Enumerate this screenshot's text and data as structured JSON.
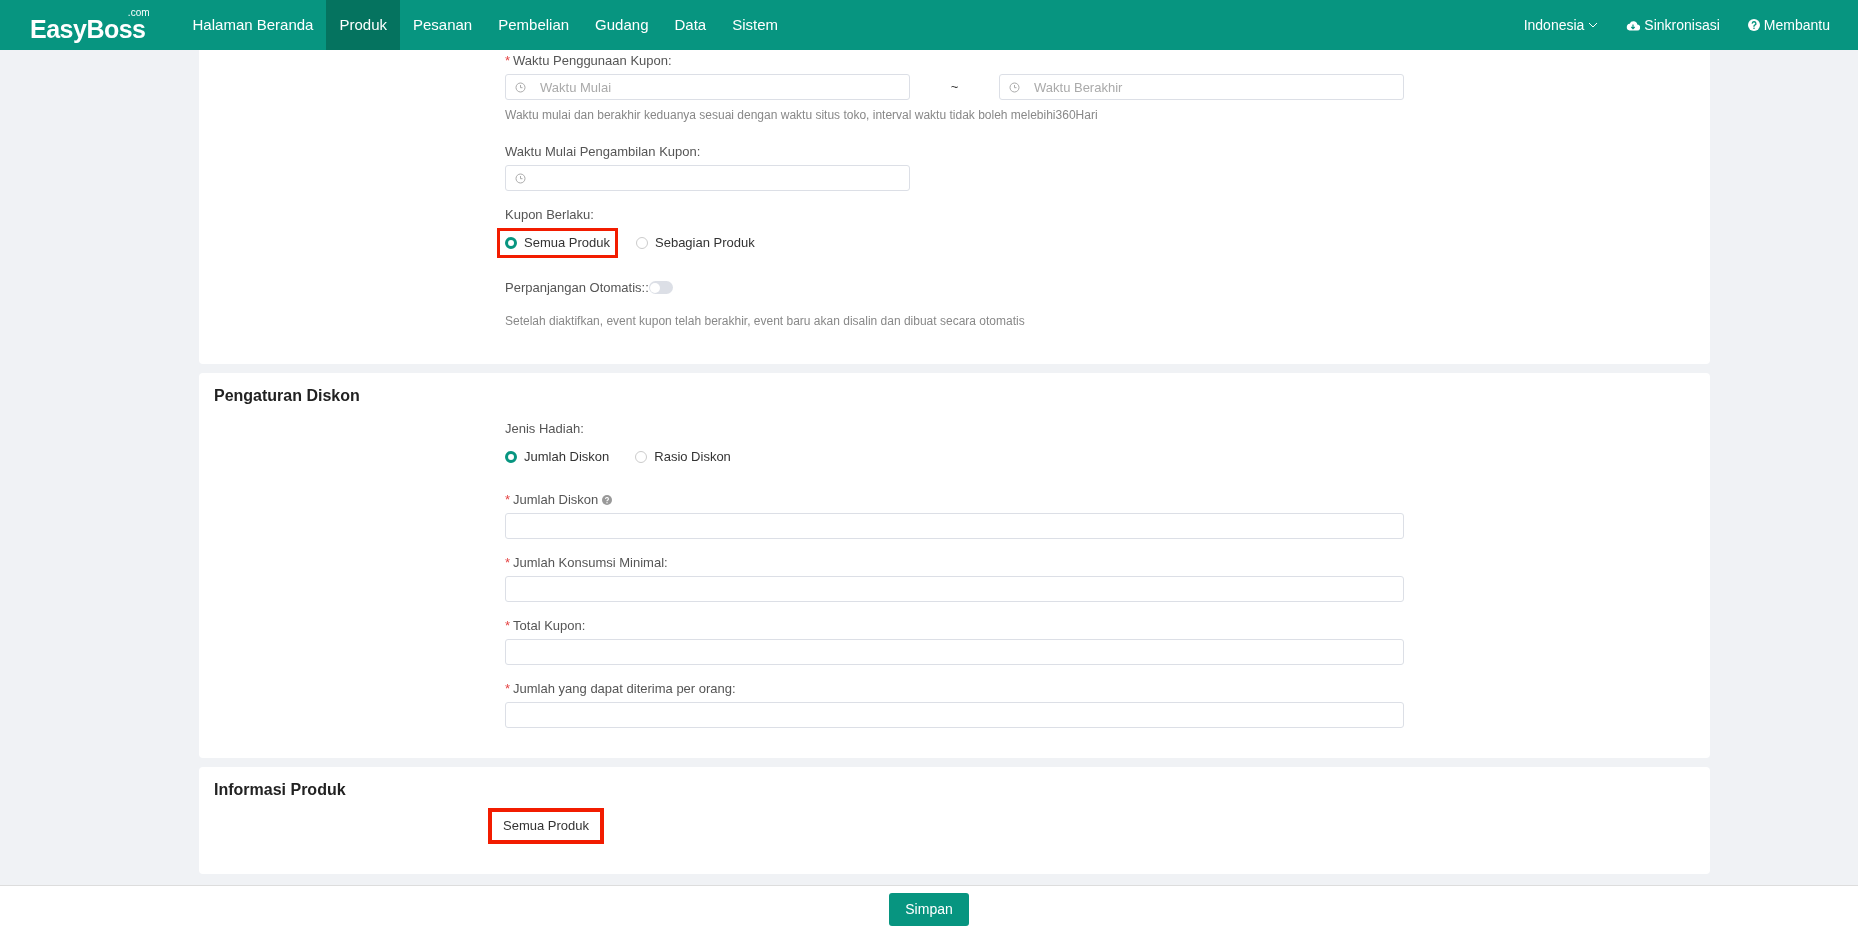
{
  "navbar": {
    "logo": "EasyBoss",
    "logo_suffix": ".com",
    "menu": [
      {
        "label": "Halaman Beranda",
        "selected": false
      },
      {
        "label": "Produk",
        "selected": true
      },
      {
        "label": "Pesanan",
        "selected": false
      },
      {
        "label": "Pembelian",
        "selected": false
      },
      {
        "label": "Gudang",
        "selected": false
      },
      {
        "label": "Data",
        "selected": false
      },
      {
        "label": "Sistem",
        "selected": false
      }
    ],
    "right": [
      {
        "kind": "dropdown",
        "label": "Indonesia"
      },
      {
        "kind": "sync",
        "label": "Sinkronisasi"
      },
      {
        "kind": "help",
        "label": "Membantu"
      }
    ]
  },
  "sections": [
    {
      "fields": [
        {
          "kind": "daterange",
          "mark": "*",
          "label": "Waktu Penggunaan Kupon:",
          "start_placeholder": "Waktu Mulai",
          "separator": "~",
          "end_placeholder": "Waktu Berakhir",
          "hint": "Waktu mulai dan berakhir keduanya sesuai dengan waktu situs toko, interval waktu tidak boleh melebihi360Hari"
        },
        {
          "kind": "datetime",
          "label": "Waktu Mulai Pengambilan Kupon:"
        },
        {
          "kind": "radio",
          "label": "Kupon Berlaku:",
          "options": [
            {
              "label": "Semua Produk",
              "selected": true,
              "highlighted": true
            },
            {
              "label": "Sebagian Produk",
              "selected": false,
              "highlighted": false
            }
          ]
        },
        {
          "kind": "toggle",
          "label": "Perpanjangan Otomatis::",
          "on": false,
          "hint": "Setelah diaktifkan, event kupon telah berakhir, event baru akan disalin dan dibuat secara otomatis"
        }
      ]
    },
    {
      "title": "Pengaturan Diskon",
      "fields": [
        {
          "kind": "radio",
          "label": "Jenis Hadiah:",
          "options": [
            {
              "label": "Jumlah Diskon",
              "selected": true,
              "highlighted": false
            },
            {
              "label": "Rasio Diskon",
              "selected": false,
              "highlighted": false
            }
          ]
        },
        {
          "kind": "input",
          "mark": "*",
          "label": "Jumlah Diskon",
          "help": true
        },
        {
          "kind": "input",
          "mark": "*",
          "label": "Jumlah Konsumsi Minimal:"
        },
        {
          "kind": "input",
          "mark": "*",
          "label": "Total Kupon:"
        },
        {
          "kind": "input",
          "mark": "*",
          "label": "Jumlah yang dapat diterima per orang:"
        }
      ]
    },
    {
      "title": "Informasi Produk",
      "fields": [
        {
          "kind": "text",
          "value": "Semua Produk",
          "highlighted": true
        }
      ]
    }
  ],
  "footer": {
    "button": "Simpan"
  }
}
